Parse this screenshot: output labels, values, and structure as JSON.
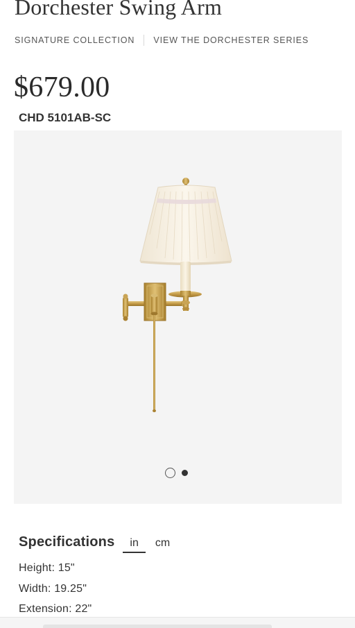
{
  "product": {
    "title": "Dorchester Swing Arm",
    "price": "$679.00",
    "sku": "CHD 5101AB-SC"
  },
  "links": {
    "collection": "SIGNATURE COLLECTION",
    "series": "VIEW THE DORCHESTER SERIES"
  },
  "gallery": {
    "image_count": 2,
    "active_index": 2,
    "colors": {
      "background": "#f4f4f4",
      "brass": "#c9a455",
      "shade": "#f6efe2"
    }
  },
  "specifications": {
    "heading": "Specifications",
    "unit_in": "in",
    "unit_cm": "cm",
    "selected_unit": "in",
    "height": "Height: 15\"",
    "width": "Width: 19.25\"",
    "extension": "Extension: 22\""
  }
}
